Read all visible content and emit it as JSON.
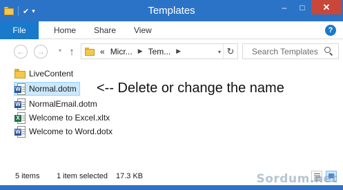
{
  "window": {
    "title": "Templates",
    "minimize_glyph": "–",
    "maximize_glyph": "□",
    "close_glyph": "✕",
    "qat_check": "✔",
    "qat_drop": "▾",
    "accent": "#2b73c6"
  },
  "ribbon": {
    "tabs": [
      "File",
      "Home",
      "Share",
      "View"
    ],
    "help_label": "?"
  },
  "navbar": {
    "back_glyph": "←",
    "forward_glyph": "→",
    "recent_glyph": "▾",
    "up_glyph": "↑",
    "breadcrumb_overflow": "«",
    "breadcrumb": [
      "Micr...",
      "Tem..."
    ],
    "crumb_sep": "▶",
    "addr_drop": "▾",
    "refresh_glyph": "↻",
    "search_placeholder": "Search Templates"
  },
  "files": [
    {
      "name": "LiveContent",
      "icon": "folder-icon",
      "selected": false
    },
    {
      "name": "Normal.dotm",
      "icon": "word-template-icon",
      "selected": true
    },
    {
      "name": "NormalEmail.dotm",
      "icon": "word-template-icon",
      "selected": false
    },
    {
      "name": "Welcome to Excel.xltx",
      "icon": "excel-template-icon",
      "selected": false
    },
    {
      "name": "Welcome to Word.dotx",
      "icon": "word-template-icon",
      "selected": false
    }
  ],
  "annotation": "<-- Delete or change the name",
  "status": {
    "items_count": "5 items",
    "selected": "1 item selected",
    "size": "17.3 KB"
  },
  "watermark": "Sordum.net",
  "icon_letters": {
    "word": "W",
    "excel": "X"
  }
}
